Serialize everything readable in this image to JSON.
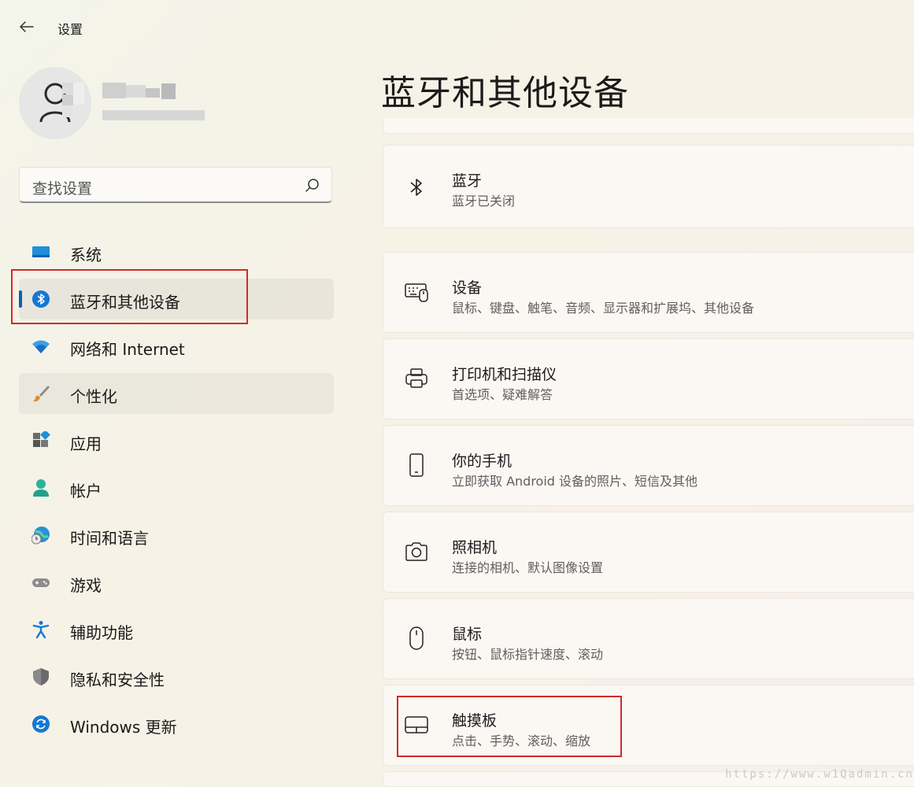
{
  "window": {
    "title": "设置"
  },
  "search": {
    "placeholder": "查找设置"
  },
  "nav": [
    {
      "label": "系统",
      "icon": "monitor-icon"
    },
    {
      "label": "蓝牙和其他设备",
      "icon": "bluetooth-icon",
      "selected": true
    },
    {
      "label": "网络和 Internet",
      "icon": "wifi-icon"
    },
    {
      "label": "个性化",
      "icon": "brush-icon"
    },
    {
      "label": "应用",
      "icon": "apps-icon"
    },
    {
      "label": "帐户",
      "icon": "account-icon"
    },
    {
      "label": "时间和语言",
      "icon": "globe-clock-icon"
    },
    {
      "label": "游戏",
      "icon": "gamepad-icon"
    },
    {
      "label": "辅助功能",
      "icon": "accessibility-icon"
    },
    {
      "label": "隐私和安全性",
      "icon": "shield-icon"
    },
    {
      "label": "Windows 更新",
      "icon": "update-icon"
    }
  ],
  "page": {
    "title": "蓝牙和其他设备"
  },
  "cards": [
    {
      "title": "蓝牙",
      "subtitle": "蓝牙已关闭",
      "icon": "bluetooth-icon"
    },
    {
      "title": "设备",
      "subtitle": "鼠标、键盘、触笔、音频、显示器和扩展坞、其他设备",
      "icon": "devices-icon"
    },
    {
      "title": "打印机和扫描仪",
      "subtitle": "首选项、疑难解答",
      "icon": "printer-icon"
    },
    {
      "title": "你的手机",
      "subtitle": "立即获取 Android 设备的照片、短信及其他",
      "icon": "phone-icon"
    },
    {
      "title": "照相机",
      "subtitle": "连接的相机、默认图像设置",
      "icon": "camera-icon"
    },
    {
      "title": "鼠标",
      "subtitle": "按钮、鼠标指针速度、滚动",
      "icon": "mouse-icon"
    },
    {
      "title": "触摸板",
      "subtitle": "点击、手势、滚动、缩放",
      "icon": "touchpad-icon"
    }
  ],
  "watermark": "https://www.w1Qadmin.cn",
  "colors": {
    "accent": "#0a5fb5",
    "highlight_box": "#d02a2a"
  }
}
